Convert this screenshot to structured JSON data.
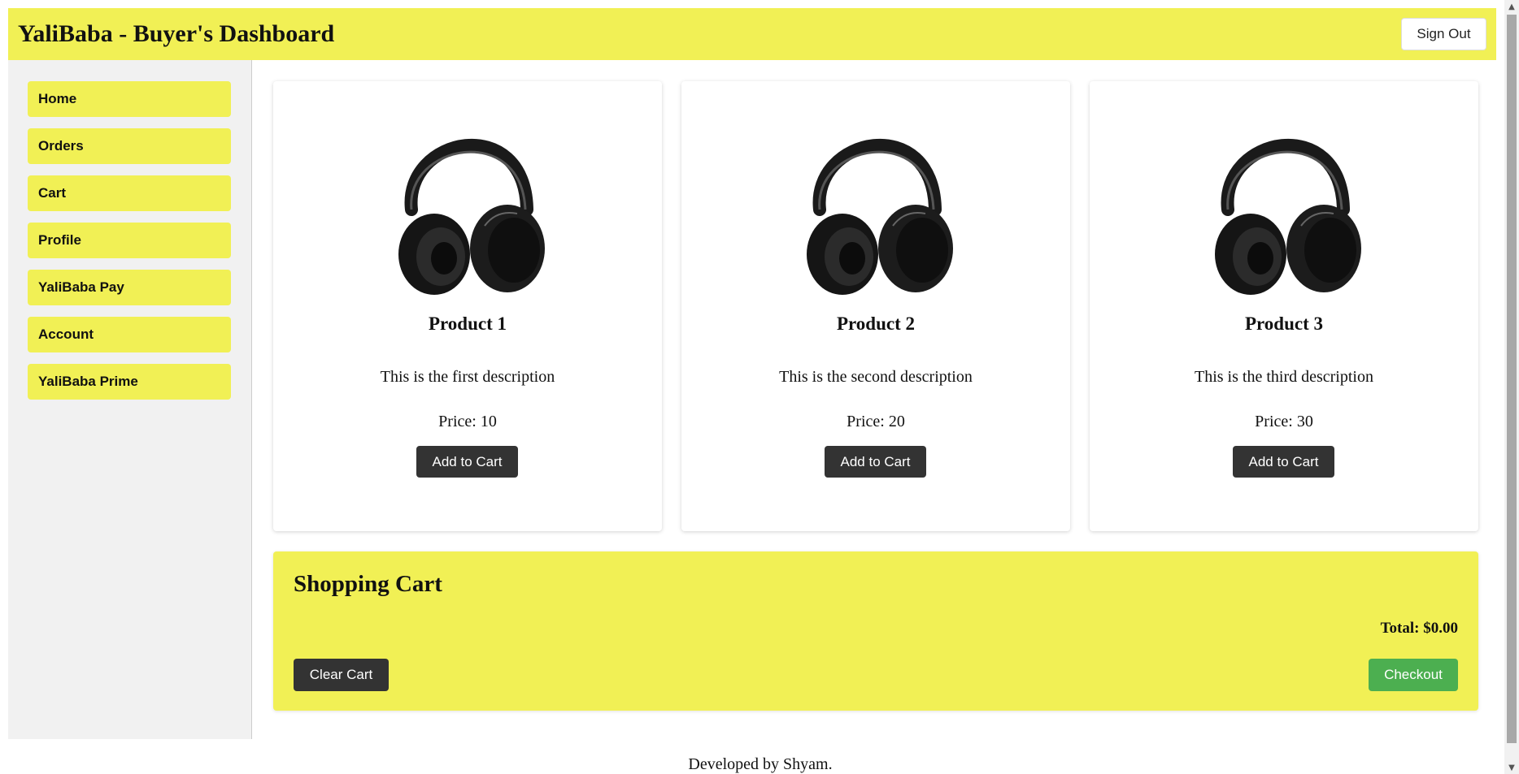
{
  "header": {
    "title": "YaliBaba - Buyer's Dashboard",
    "signout_label": "Sign Out"
  },
  "sidebar": {
    "items": [
      {
        "label": "Home"
      },
      {
        "label": "Orders"
      },
      {
        "label": "Cart"
      },
      {
        "label": "Profile"
      },
      {
        "label": "YaliBaba Pay"
      },
      {
        "label": "Account"
      },
      {
        "label": "YaliBaba Prime"
      }
    ]
  },
  "products": [
    {
      "name": "Product 1",
      "description": "This is the first description",
      "price": "Price: 10",
      "button": "Add to Cart",
      "icon": "headphones-image"
    },
    {
      "name": "Product 2",
      "description": "This is the second description",
      "price": "Price: 20",
      "button": "Add to Cart",
      "icon": "headphones-image"
    },
    {
      "name": "Product 3",
      "description": "This is the third description",
      "price": "Price: 30",
      "button": "Add to Cart",
      "icon": "headphones-image"
    }
  ],
  "cart": {
    "title": "Shopping Cart",
    "total": "Total: $0.00",
    "clear_label": "Clear Cart",
    "checkout_label": "Checkout"
  },
  "footer": {
    "text": "Developed by Shyam."
  },
  "colors": {
    "accent_yellow": "#f1f055",
    "dark_button": "#333333",
    "checkout_green": "#4caf50",
    "sidebar_bg": "#f1f1f1"
  }
}
